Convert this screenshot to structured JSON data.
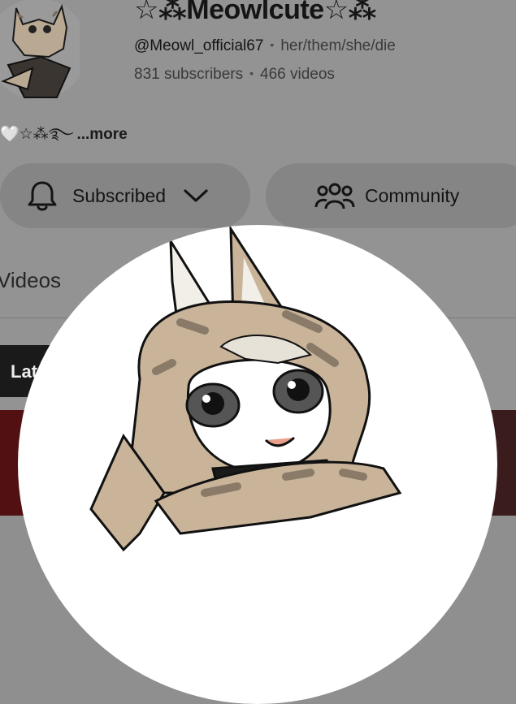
{
  "channel": {
    "name": "☆⁂Meowlcute☆⁂",
    "handle": "@Meowl_official67",
    "pronouns": "her/them/she/die",
    "subscribers": "831 subscribers",
    "videos": "466 videos",
    "description": "🤍☆⁂࿐",
    "more_label": "...more"
  },
  "actions": {
    "subscribed_label": "Subscribed",
    "community_label": "Community"
  },
  "tabs": {
    "videos_label": "Videos"
  },
  "filters": {
    "latest_label": "Lat"
  },
  "separator": "•",
  "colors": {
    "overlay": "#939393",
    "avatar_fill": "#c9b49a",
    "avatar_spots": "#8a7a68"
  }
}
